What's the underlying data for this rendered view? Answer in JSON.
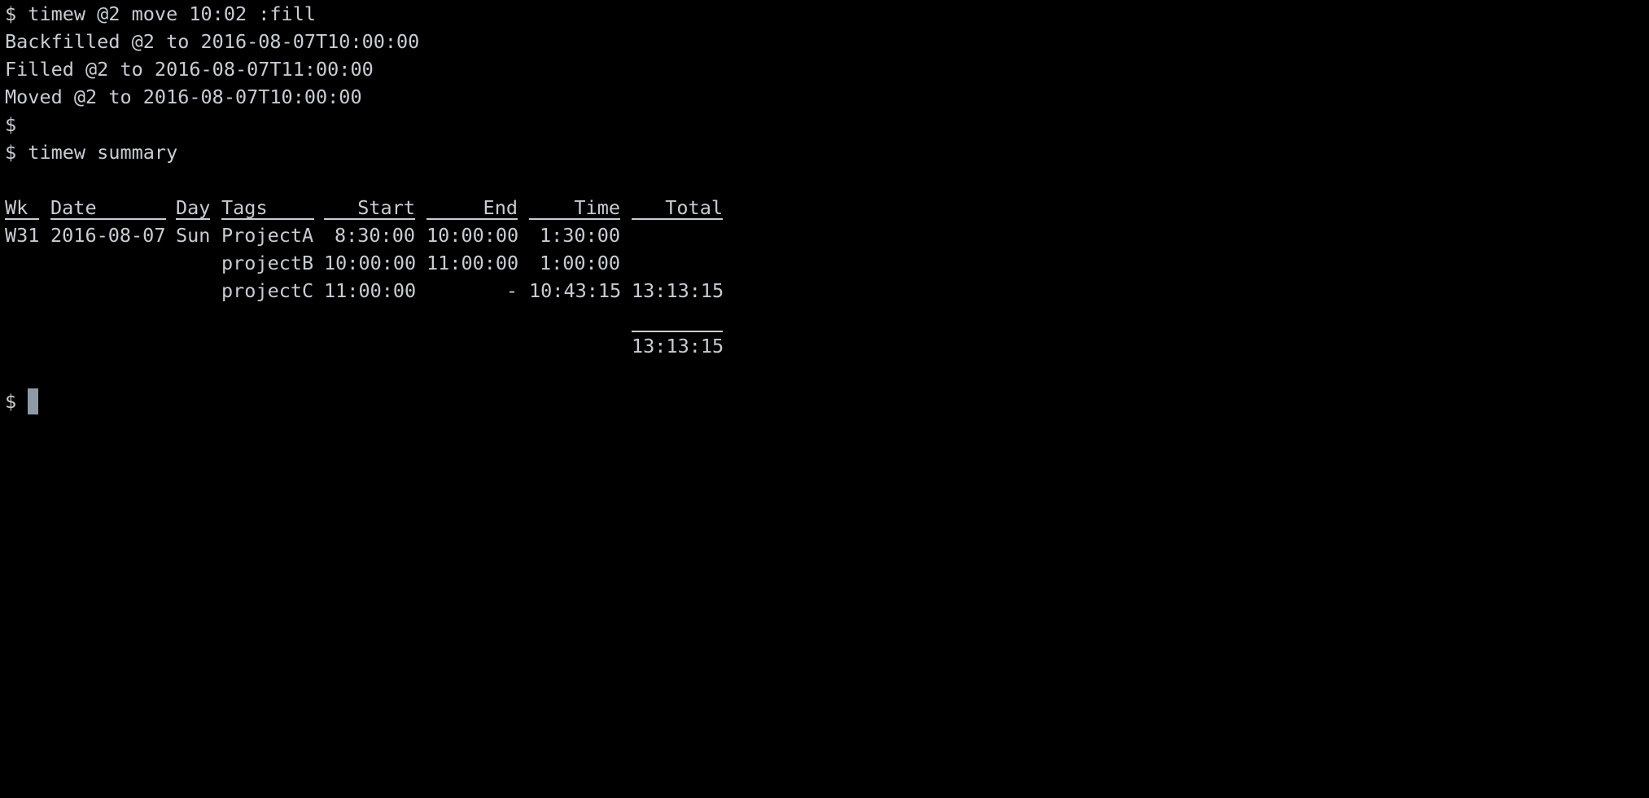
{
  "colors": {
    "background": "#000000",
    "text": "#c7cdd3",
    "cursor": "#8e9aa6"
  },
  "terminal": {
    "prompt": "$",
    "lines": [
      "$ timew @2 move 10:02 :fill",
      "Backfilled @2 to 2016-08-07T10:00:00",
      "Filled @2 to 2016-08-07T11:00:00",
      "Moved @2 to 2016-08-07T10:00:00",
      "$",
      "$ timew summary"
    ],
    "summary": {
      "headers": {
        "wk": "Wk",
        "date": "Date",
        "day": "Day",
        "tags": "Tags",
        "start": "Start",
        "end": "End",
        "time": "Time",
        "total": "Total"
      },
      "rows": [
        {
          "wk": "W31",
          "date": "2016-08-07",
          "day": "Sun",
          "tags": "ProjectA",
          "start": "8:30:00",
          "end": "10:00:00",
          "time": "1:30:00",
          "total": ""
        },
        {
          "wk": "",
          "date": "",
          "day": "",
          "tags": "projectB",
          "start": "10:00:00",
          "end": "11:00:00",
          "time": "1:00:00",
          "total": ""
        },
        {
          "wk": "",
          "date": "",
          "day": "",
          "tags": "projectC",
          "start": "11:00:00",
          "end": "-",
          "time": "10:43:15",
          "total": "13:13:15"
        }
      ],
      "grand_total": "13:13:15"
    }
  }
}
